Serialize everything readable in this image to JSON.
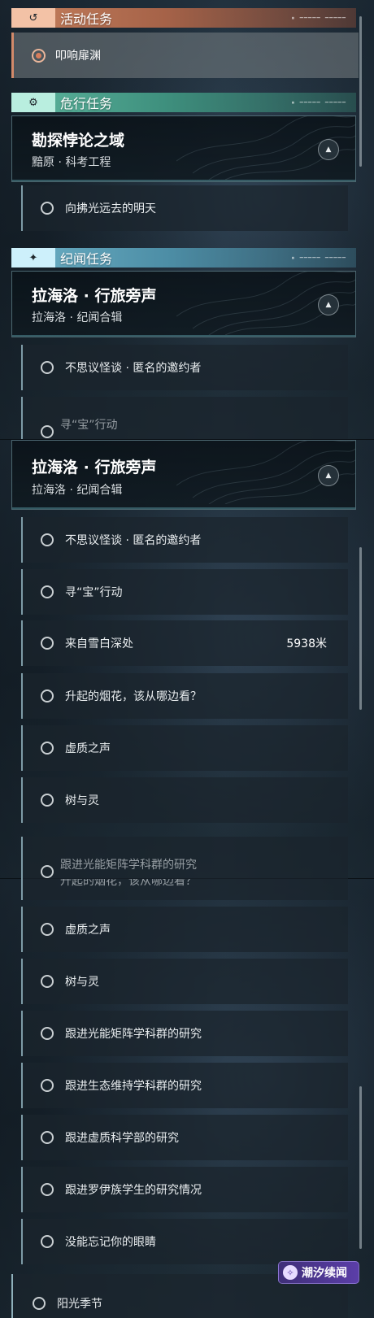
{
  "panel1": {
    "active_header": {
      "title": "活动任务",
      "icon": "return-arrow-icon",
      "deco": "▪ ━━━━━ ━━━━━"
    },
    "active_quest": {
      "label": "叩响扉渊",
      "state": "tracked"
    },
    "danger_header": {
      "title": "危行任务",
      "icon": "gear-eye-icon",
      "deco": "▪ ━━━━━ ━━━━━"
    },
    "danger_group": {
      "title": "勘探悖论之域",
      "subtitle": "黯原 · 科考工程",
      "toggle_icon": "chevron-up-icon"
    },
    "danger_quests": [
      {
        "label": "向拂光远去的明天"
      }
    ],
    "story_header": {
      "title": "纪闻任务",
      "icon": "sparkle-icon",
      "deco": "▪ ━━━━━ ━━━━━"
    },
    "story_group": {
      "title": "拉海洛 · 行旅旁声",
      "subtitle": "拉海洛 · 纪闻合辑",
      "toggle_icon": "chevron-up-icon"
    },
    "story_quests": [
      {
        "label": "不思议怪谈 · 匿名的邀约者"
      }
    ],
    "cut_label": "寻“宝”行动"
  },
  "panel2": {
    "group": {
      "title": "拉海洛 · 行旅旁声",
      "subtitle": "拉海洛 · 纪闻合辑",
      "toggle_icon": "chevron-up-icon"
    },
    "quests": [
      {
        "label": "不思议怪谈 · 匿名的邀约者",
        "distance": ""
      },
      {
        "label": "寻“宝”行动",
        "distance": ""
      },
      {
        "label": "来自雪白深处",
        "distance": "5938米"
      },
      {
        "label": "升起的烟花，该从哪边看？",
        "distance": ""
      },
      {
        "label": "虚质之声",
        "distance": ""
      },
      {
        "label": "树与灵",
        "distance": ""
      }
    ],
    "cut_label": "跟进光能矩阵学科群的研究"
  },
  "panel3": {
    "cut_label_top": "升起的烟花，该从哪边看？",
    "quests": [
      {
        "label": "虚质之声"
      },
      {
        "label": "树与灵"
      },
      {
        "label": "跟进光能矩阵学科群的研究"
      },
      {
        "label": "跟进生态维持学科群的研究"
      },
      {
        "label": "跟进虚质科学部的研究"
      },
      {
        "label": "跟进罗伊族学生的研究情况"
      },
      {
        "label": "没能忘记你的眼睛"
      }
    ],
    "cut_label": "阳光季节"
  },
  "logo": {
    "text": "潮汐续闻",
    "icon": "tide-logo-icon"
  },
  "colors": {
    "active": "#c6805d",
    "danger": "#5db69e",
    "story": "#6cb0c6"
  }
}
